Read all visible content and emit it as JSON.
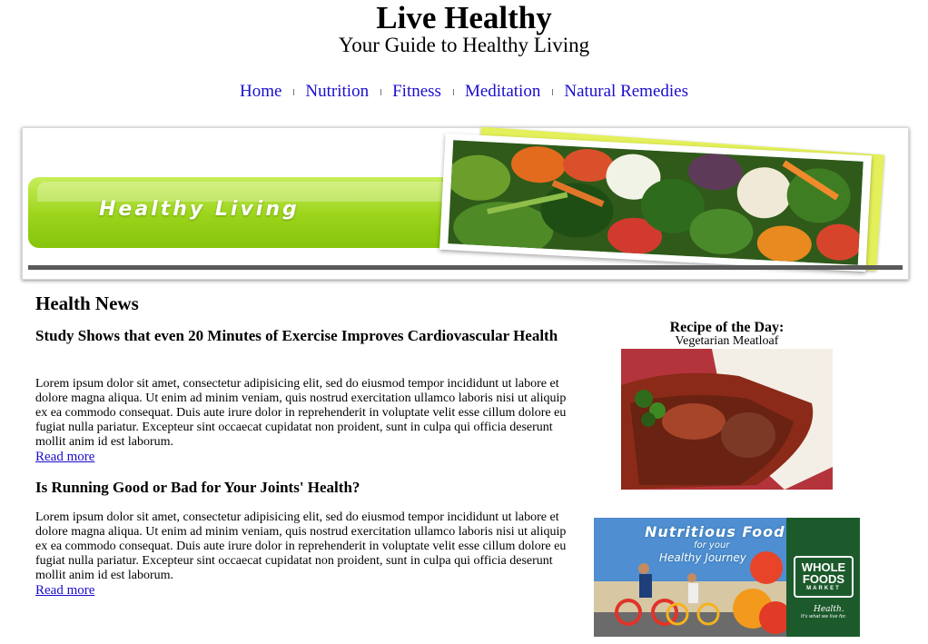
{
  "header": {
    "title": "Live Healthy",
    "subtitle": "Your Guide to Healthy Living"
  },
  "nav": {
    "items": [
      "Home",
      "Nutrition",
      "Fitness",
      "Meditation",
      "Natural Remedies"
    ]
  },
  "banner": {
    "text": "Healthy Living"
  },
  "news": {
    "heading": "Health News",
    "articles": [
      {
        "title": "Study Shows that even 20 Minutes of Exercise Improves Cardiovascular Health",
        "body": "Lorem ipsum dolor sit amet, consectetur adipisicing elit, sed do eiusmod tempor incididunt ut labore et dolore magna aliqua. Ut enim ad minim veniam, quis nostrud exercitation ullamco laboris nisi ut aliquip ex ea commodo consequat. Duis aute irure dolor in reprehenderit in voluptate velit esse cillum dolore eu fugiat nulla pariatur. Excepteur sint occaecat cupidatat non proident, sunt in culpa qui officia deserunt mollit anim id est laborum.",
        "link": "Read more"
      },
      {
        "title": "Is Running Good or Bad for Your Joints' Health?",
        "body": "Lorem ipsum dolor sit amet, consectetur adipisicing elit, sed do eiusmod tempor incididunt ut labore et dolore magna aliqua. Ut enim ad minim veniam, quis nostrud exercitation ullamco laboris nisi ut aliquip ex ea commodo consequat. Duis aute irure dolor in reprehenderit in voluptate velit esse cillum dolore eu fugiat nulla pariatur. Excepteur sint occaecat cupidatat non proident, sunt in culpa qui officia deserunt mollit anim id est laborum.",
        "link": "Read more"
      }
    ]
  },
  "sidebar": {
    "recipe_title": "Recipe of the Day:",
    "recipe_name": "Vegetarian Meatloaf",
    "ad": {
      "headline": "Nutritious Food",
      "line1": "for your",
      "line2": "Healthy Journey",
      "logo_line1": "WHOLE",
      "logo_line2": "FOODS",
      "logo_line3": "MARKET",
      "tagline": "Health.",
      "tagline2": "It's what we live for."
    }
  },
  "colors": {
    "link": "#1a0dcc",
    "banner_green": "#9bd41a",
    "whole_foods_green": "#1c5a2c"
  }
}
